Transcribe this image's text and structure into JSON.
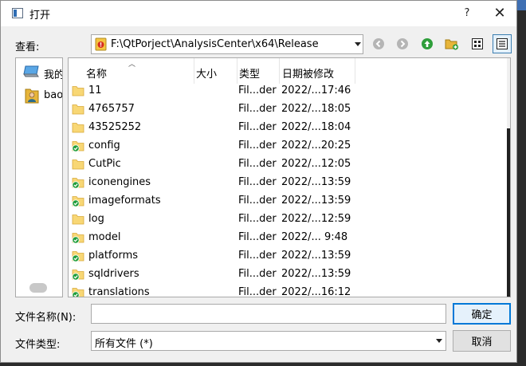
{
  "window": {
    "title": "打开",
    "help_label": "?",
    "close_label": "✕"
  },
  "lookin": {
    "label": "查看:",
    "path": "F:\\QtPorject\\AnalysisCenter\\x64\\Release"
  },
  "toolbar": {
    "back_icon": "back-arrow-icon",
    "forward_icon": "forward-arrow-icon",
    "parent_icon": "up-arrow-icon",
    "new_folder_icon": "new-folder-icon",
    "list_view_icon": "list-view-icon",
    "detail_view_icon": "detail-view-icon"
  },
  "sidebar": {
    "items": [
      {
        "label": "我的",
        "icon": "computer-icon"
      },
      {
        "label": "bao",
        "icon": "user-folder-icon"
      }
    ]
  },
  "columns": {
    "name": "名称",
    "size": "大小",
    "type": "类型",
    "date": "日期被修改"
  },
  "files": [
    {
      "name": "11",
      "type": "Fil...der",
      "date": "2022/...17:46",
      "synced": false
    },
    {
      "name": "4765757",
      "type": "Fil...der",
      "date": "2022/...18:05",
      "synced": false
    },
    {
      "name": "43525252",
      "type": "Fil...der",
      "date": "2022/...18:04",
      "synced": false
    },
    {
      "name": "config",
      "type": "Fil...der",
      "date": "2022/...20:25",
      "synced": true
    },
    {
      "name": "CutPic",
      "type": "Fil...der",
      "date": "2022/...12:05",
      "synced": false
    },
    {
      "name": "iconengines",
      "type": "Fil...der",
      "date": "2022/...13:59",
      "synced": true
    },
    {
      "name": "imageformats",
      "type": "Fil...der",
      "date": "2022/...13:59",
      "synced": true
    },
    {
      "name": "log",
      "type": "Fil...der",
      "date": "2022/...12:59",
      "synced": false
    },
    {
      "name": "model",
      "type": "Fil...der",
      "date": "2022/... 9:48",
      "synced": true
    },
    {
      "name": "platforms",
      "type": "Fil...der",
      "date": "2022/...13:59",
      "synced": true
    },
    {
      "name": "sqldrivers",
      "type": "Fil...der",
      "date": "2022/...13:59",
      "synced": true
    },
    {
      "name": "translations",
      "type": "Fil...der",
      "date": "2022/...16:12",
      "synced": true
    }
  ],
  "filename": {
    "label": "文件名称(N):",
    "value": ""
  },
  "filetype": {
    "label": "文件类型:",
    "value": "所有文件 (*)"
  },
  "buttons": {
    "ok": "确定",
    "cancel": "取消"
  },
  "colors": {
    "accent": "#0078d7",
    "folder": "#f8d775",
    "sync_badge": "#1f9d3a"
  }
}
